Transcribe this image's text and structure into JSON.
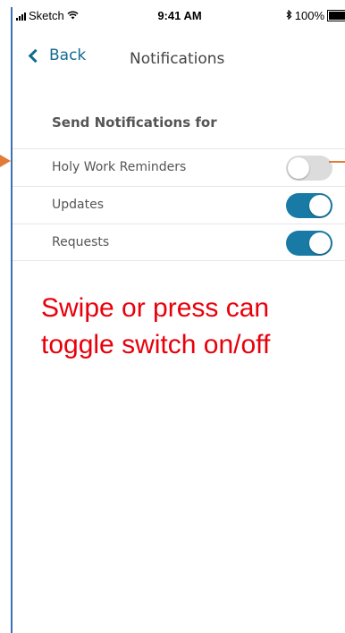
{
  "status_bar": {
    "carrier": "Sketch",
    "time": "9:41 AM",
    "bluetooth_icon": "bluetooth-icon",
    "battery": "100%"
  },
  "nav": {
    "back_label": "Back",
    "title": "Notifications"
  },
  "section_header": "Send Notifications for",
  "settings": [
    {
      "label": "Holy Work Reminders",
      "enabled": false
    },
    {
      "label": "Updates",
      "enabled": true
    },
    {
      "label": "Requests",
      "enabled": true
    }
  ],
  "annotation": {
    "caption": "Swipe or press can toggle switch on/off"
  },
  "colors": {
    "accent": "#1a7aa6",
    "toggle_off": "#dcdcdc",
    "annotation_text": "#e8000b",
    "annotation_arrow": "#e27b35"
  }
}
